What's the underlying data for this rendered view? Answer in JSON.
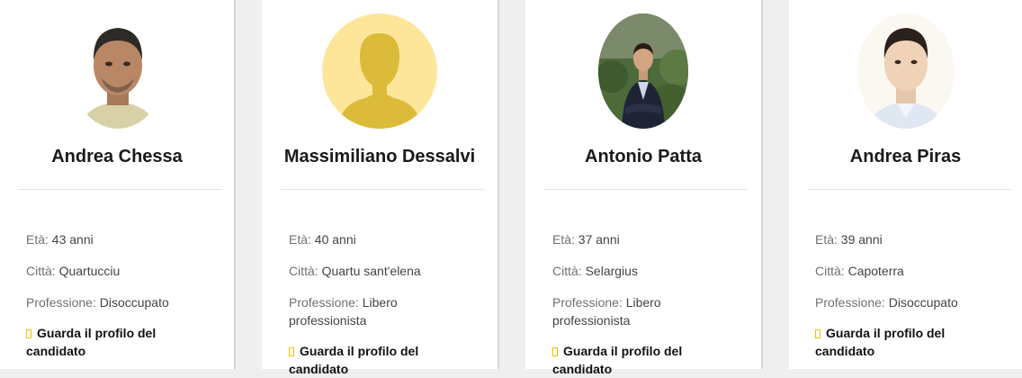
{
  "candidates": [
    {
      "name": "Andrea Chessa",
      "eta_label": "Età:",
      "eta_value": "43 anni",
      "citta_label": "Città:",
      "citta_value": "Quartucciu",
      "prof_label": "Professione:",
      "prof_value": "Disoccupato",
      "link_label": "Guarda il profilo del candidato",
      "avatar": "photo"
    },
    {
      "name": "Massimiliano Dessalvi",
      "eta_label": "Età:",
      "eta_value": "40 anni",
      "citta_label": "Città:",
      "citta_value": "Quartu sant'elena",
      "prof_label": "Professione:",
      "prof_value": "Libero professionista",
      "link_label": "Guarda il profilo del candidato",
      "avatar": "placeholder-person-icon"
    },
    {
      "name": "Antonio Patta",
      "eta_label": "Età:",
      "eta_value": "37 anni",
      "citta_label": "Città:",
      "citta_value": "Selargius",
      "prof_label": "Professione:",
      "prof_value": "Libero professionista",
      "link_label": "Guarda il profilo del candidato",
      "avatar": "photo"
    },
    {
      "name": "Andrea Piras",
      "eta_label": "Età:",
      "eta_value": "39 anni",
      "citta_label": "Città:",
      "citta_value": "Capoterra",
      "prof_label": "Professione:",
      "prof_value": "Disoccupato",
      "link_label": "Guarda il profilo del candidato",
      "avatar": "photo"
    }
  ],
  "colors": {
    "background": "#efefef",
    "card": "#ffffff",
    "placeholder_bg": "#fde69a",
    "placeholder_figure": "#dcbb3a",
    "link_icon": "#f2c200"
  }
}
